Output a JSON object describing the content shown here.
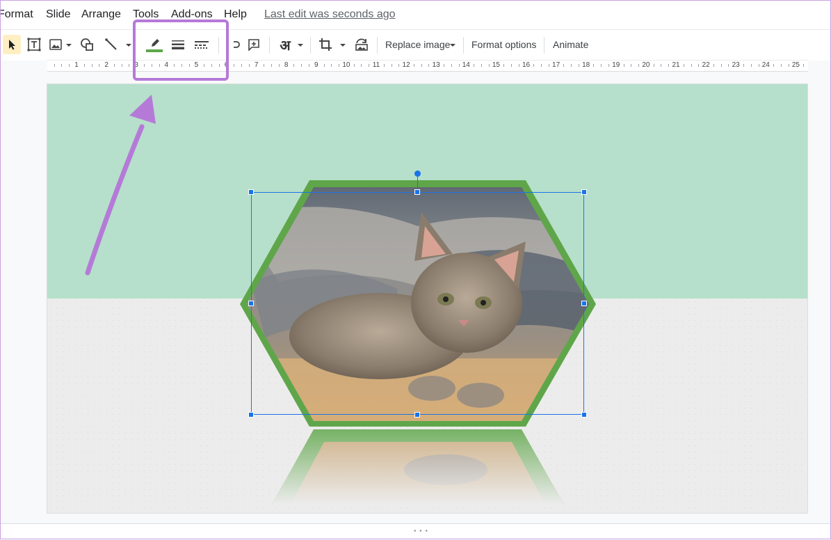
{
  "menu": {
    "items": [
      "Format",
      "Slide",
      "Arrange",
      "Tools",
      "Add-ons",
      "Help"
    ],
    "last_edit": "Last edit was seconds ago"
  },
  "toolbar": {
    "replace_image_label": "Replace image",
    "format_options_label": "Format options",
    "animate_label": "Animate",
    "input_tools_glyph": "अ"
  },
  "ruler": {
    "numbers": [
      "1",
      "2",
      "3",
      "4",
      "5",
      "6",
      "7",
      "8",
      "9",
      "10",
      "11",
      "12",
      "13",
      "14",
      "15",
      "16",
      "17",
      "18",
      "19",
      "20",
      "21",
      "22",
      "23",
      "24",
      "25"
    ]
  },
  "colors": {
    "slide_top": "#b6e0cb",
    "slide_bottom": "#ececec",
    "hexagon_border": "#5fa64a",
    "highlight": "#b57ad8",
    "selection": "#1a73e8"
  },
  "icons": [
    "cursor-icon",
    "textbox-icon",
    "image-icon",
    "shapes-icon",
    "line-icon",
    "border-color-icon",
    "border-weight-icon",
    "border-dash-icon",
    "link-icon",
    "comment-icon",
    "input-tools-icon",
    "crop-icon",
    "reset-image-icon",
    "rotate-handle-icon"
  ]
}
